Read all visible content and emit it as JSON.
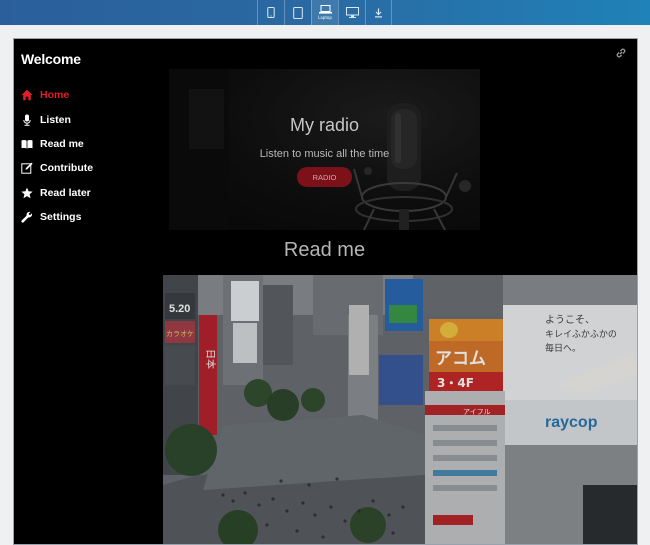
{
  "toolbar": {
    "devices": [
      {
        "icon": "phone-icon",
        "label": ""
      },
      {
        "icon": "tablet-icon",
        "label": ""
      },
      {
        "icon": "laptop-icon",
        "label": "Laptop",
        "active": true
      },
      {
        "icon": "desktop-icon",
        "label": ""
      },
      {
        "icon": "download-icon",
        "label": ""
      }
    ],
    "accent": "#2a6aa3"
  },
  "sidebar": {
    "brand": "Welcome",
    "items": [
      {
        "label": "Home",
        "icon": "home-icon",
        "active": true
      },
      {
        "label": "Listen",
        "icon": "microphone-icon"
      },
      {
        "label": "Read me",
        "icon": "book-icon"
      },
      {
        "label": "Contribute",
        "icon": "edit-icon"
      },
      {
        "label": "Read later",
        "icon": "star-icon"
      },
      {
        "label": "Settings",
        "icon": "wrench-icon"
      }
    ],
    "active_color": "#e01f2a"
  },
  "hero": {
    "title": "My radio",
    "subtitle": "Listen to music all the time",
    "button_label": "RADIO",
    "button_color": "#7c1119"
  },
  "section": {
    "title": "Read me"
  },
  "city_image": {
    "signs": [
      "5.20",
      "アコム",
      "3・4F",
      "ようこそ、",
      "キレイふかふかの",
      "毎日へ。",
      "raycop",
      "アイフル",
      "日本",
      "カラオケ"
    ]
  }
}
